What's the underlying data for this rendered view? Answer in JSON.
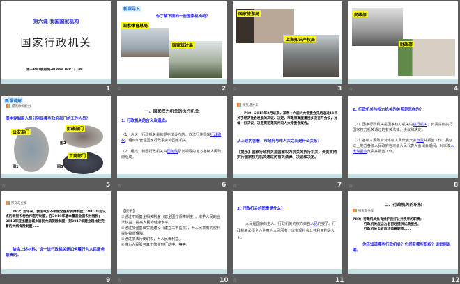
{
  "slides": [
    {
      "number": "1",
      "subtitle": "第六课 我国国家机构",
      "title": "国家行政机关",
      "footer": "第一PPT模板网-WWW.1PPT.COM"
    },
    {
      "number": "2",
      "tag": "新课导入",
      "question": "你了解下面的一些国家机构吗？",
      "labels": [
        "国家体育总局",
        "国家统计局"
      ]
    },
    {
      "number": "3",
      "labels": [
        "国家旅游局",
        "上海知识产权局"
      ]
    },
    {
      "number": "4",
      "labels": [
        "民政部",
        "财政部"
      ]
    },
    {
      "number": "5",
      "tag": "新课讲解",
      "logo": "提高你的能力",
      "question": "图中穿制服人员分别是哪些政府部门的工作人员？",
      "labels": [
        "公安部门",
        "财政部门",
        "工商部门"
      ],
      "captions": [
        "图1",
        "图2",
        "图3"
      ]
    },
    {
      "number": "6",
      "heading": "一、国家权力机关的执行机关",
      "sub": "1. 行政机关的含义及组成。",
      "p1a": "（1）含义：行政机关是依据宪法设立的，依法行使国家",
      "p1link": "行政职权",
      "p1b": "，组织和管理国家行政事务的国家机关。",
      "p2a": "（2）组成：我国行政机关由",
      "p2link": "国务院",
      "p2b": "及其领导的地方各级人民政府组成。"
    },
    {
      "number": "7",
      "logo": "探究与分享",
      "body": "P80：2015年2月以来，某市十六届人大常委会先后通过11个关于经济社会发展的决议、决定。市政府高度重视多次召开会议，对每一份决议、决定贯彻落实并向人大常委会报告。",
      "question": "从上述内容看，市政府与市人大之间是什么关系？",
      "hint": "【提示】国家行政机关是国家权力机关的执行机关，负责贯彻执行国家权力机关通过的有关法律、决议和决定。"
    },
    {
      "number": "8",
      "heading": "2. 行政机关与权力机关的关系是怎样的？",
      "p1a": "（1）国家行政机关是国家权力机关的",
      "p1link": "执行机关",
      "p1b": "，负责贯彻执行国家权力机关通过的有关法律、决议和决定。",
      "p2a": "（2）各级人民政府对本级人民代表大会",
      "p2link": "负责",
      "p2b": "并报告工作；县级以上地方各级人民政府在本级人民代表大会闭会期间，对本级",
      "p2link2": "人大常委会",
      "p2c": "负责并报告工作。"
    },
    {
      "number": "9",
      "logo": "探究与分享",
      "body": "P82：近年来，我国政府不断健全医疗保障制度。2003年起试点的新型农村合作医疗制度，在2010年基本覆盖全国农村居民；2012年提出建立城乡居民大病保险制度，到2017年建立起比较完善的大病保险制度……",
      "question": "结合上述材料，说一说行政机关是如何履行为人民服务职责的。"
    },
    {
      "number": "10",
      "hint_title": "【提示】",
      "items": [
        "①通过不断健全相关制度（健全医疗保障制度），维护人民的合法权益，提高人民的健康水平。",
        "②通过加强基础实施建设（建立三甲医院），为人民享有的权利提供物质保障。",
        "③通过依法行使职权，为人民谋利益。",
        "④将为人民服务真正落实到行动中。等等。"
      ]
    },
    {
      "number": "11",
      "heading": "3. 行政机关的职责是什么？",
      "pa": "人民是国家的主人，行政机关的权力来自",
      "plink": "人民",
      "pb": "的授予。行政机关必须全心全意为人民服务，以实现社会公共利益的最大化。"
    },
    {
      "number": "12",
      "heading": "二、行政机关的职权",
      "logo": "探究与分享",
      "lines": [
        "P80：行政机关负有维护良好公共秩序的职责；",
        "行政机关应当为老百姓提供优质服务；",
        "行政机关负有市场监管职责……"
      ],
      "question": "你还知道哪些行政机关？它们有哪些职权？请举例说明。"
    }
  ],
  "colors": {
    "background": "#5b5b5b",
    "band": "#c3e2e6",
    "accent": "#1a1ae6"
  }
}
